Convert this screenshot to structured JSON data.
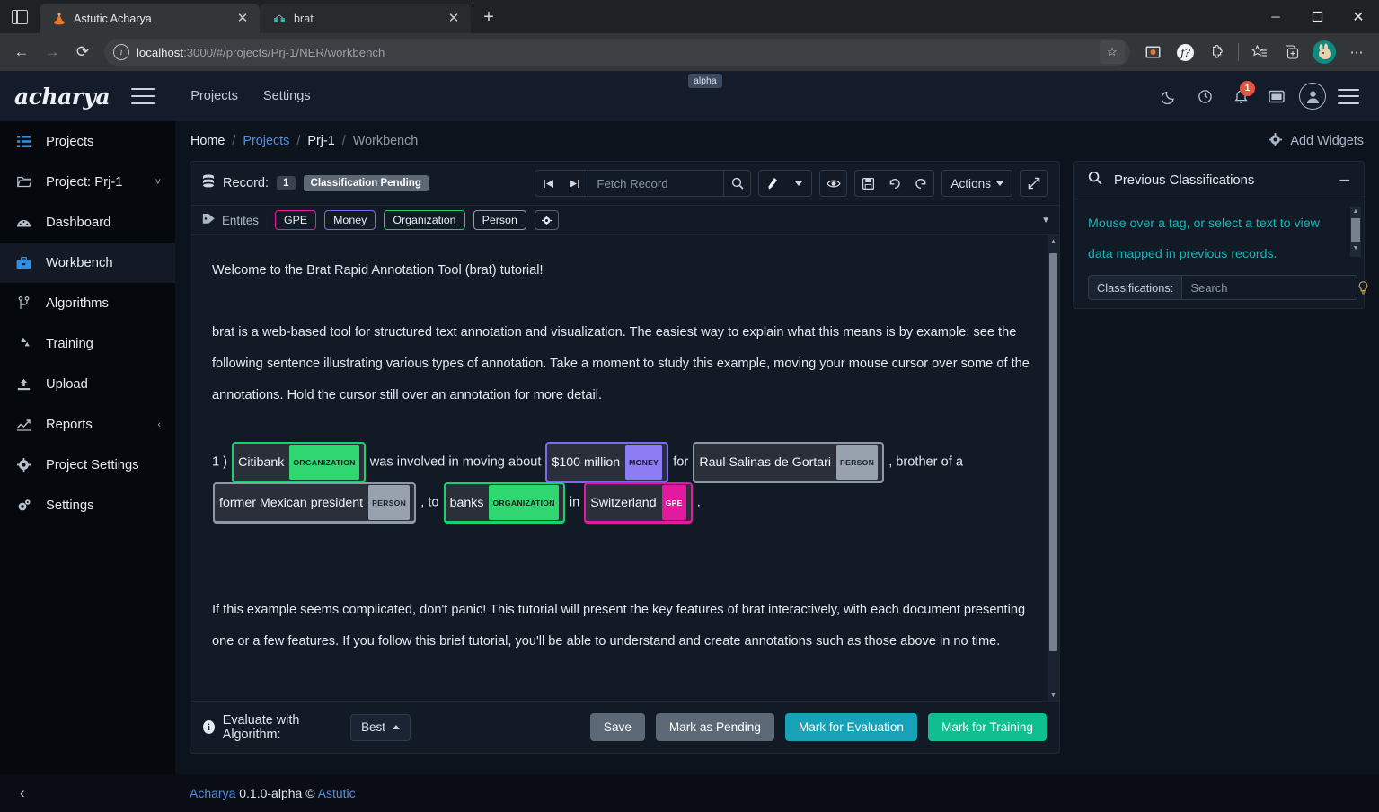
{
  "browser": {
    "tabs": [
      {
        "title": "Astutic Acharya",
        "favicon": "acharya-favicon",
        "active": true
      },
      {
        "title": "brat",
        "favicon": "brat-favicon",
        "active": false
      }
    ],
    "new_tab_label": "+",
    "nav": {
      "back": "←",
      "forward": "→",
      "reload": "⟳"
    },
    "url_prefix": "localhost",
    "url_rest": ":3000/#/projects/Prj-1/NER/workbench",
    "window": {
      "minimize": "─",
      "maximize": "☐",
      "close": "✕"
    }
  },
  "header": {
    "brand": "acharya",
    "alpha_badge": "alpha",
    "links": [
      {
        "label": "Projects"
      },
      {
        "label": "Settings"
      }
    ],
    "notification_count": "1"
  },
  "sidebar": {
    "items": [
      {
        "label": "Projects",
        "icon": "list-icon",
        "active": false,
        "accent": true
      },
      {
        "label": "Project: Prj-1",
        "icon": "folder-icon",
        "active": false,
        "accent": false,
        "caret": "˅"
      },
      {
        "label": "Dashboard",
        "icon": "dashboard-icon",
        "active": false,
        "accent": false
      },
      {
        "label": "Workbench",
        "icon": "briefcase-icon",
        "active": true,
        "accent": true
      },
      {
        "label": "Algorithms",
        "icon": "branch-icon",
        "active": false,
        "accent": false
      },
      {
        "label": "Training",
        "icon": "recycle-icon",
        "active": false,
        "accent": false
      },
      {
        "label": "Upload",
        "icon": "upload-icon",
        "active": false,
        "accent": false
      },
      {
        "label": "Reports",
        "icon": "chart-line-icon",
        "active": false,
        "accent": false,
        "caret": "‹"
      },
      {
        "label": "Project Settings",
        "icon": "gear-icon",
        "active": false,
        "accent": false
      },
      {
        "label": "Settings",
        "icon": "gears-icon",
        "active": false,
        "accent": false
      }
    ],
    "collapse": "‹"
  },
  "breadcrumb": {
    "home": "Home",
    "projects": "Projects",
    "project": "Prj-1",
    "current": "Workbench",
    "separator": "/"
  },
  "add_widgets": {
    "label": "Add Widgets",
    "icon": "gear-icon"
  },
  "record": {
    "label": "Record:",
    "number": "1",
    "status": "Classification Pending",
    "fetch_placeholder": "Fetch Record",
    "fetch_value": "",
    "actions_label": "Actions",
    "buttons": {
      "first": "⏮",
      "last": "⏭",
      "search": "🔍",
      "brush": "🖌",
      "eye": "◉",
      "save": "💾",
      "undo": "↺",
      "redo": "↻",
      "expand": "⤡"
    }
  },
  "entities": {
    "label": "Entites",
    "icon": "tag-icon",
    "tags": [
      {
        "label": "GPE",
        "color": "#e3199e"
      },
      {
        "label": "Money",
        "color": "#7a6bf0"
      },
      {
        "label": "Organization",
        "color": "#18d26e"
      },
      {
        "label": "Person",
        "color": "#8e99a6"
      }
    ],
    "settings_icon": "gear-icon"
  },
  "document": {
    "paragraph1": "Welcome to the Brat Rapid Annotation Tool (brat) tutorial!",
    "paragraph2": "brat is a web-based tool for structured text annotation and visualization. The easiest way to explain what this means is by example: see the following sentence illustrating various types of annotation. Take a moment to study this example, moving your mouse cursor over some of the annotations. Hold the cursor still over an annotation for more detail.",
    "annotated_sentence": {
      "number": "1 )",
      "segments": [
        {
          "type": "ann",
          "text": "Citibank",
          "label": "ORGANIZATION",
          "cls": "org"
        },
        {
          "type": "text",
          "text": " was involved in moving about "
        },
        {
          "type": "ann",
          "text": "$100 million",
          "label": "MONEY",
          "cls": "money"
        },
        {
          "type": "text",
          "text": " for "
        },
        {
          "type": "ann",
          "text": "Raul Salinas de Gortari",
          "label": "PERSON",
          "cls": "person"
        },
        {
          "type": "text",
          "text": ", brother of a "
        },
        {
          "type": "ann",
          "text": "former Mexican president",
          "label": "PERSON",
          "cls": "person"
        },
        {
          "type": "text",
          "text": ", to "
        },
        {
          "type": "ann",
          "text": "banks",
          "label": "ORGANIZATION",
          "cls": "org"
        },
        {
          "type": "text",
          "text": " in "
        },
        {
          "type": "ann",
          "text": "Switzerland",
          "label": "GPE",
          "cls": "gpe"
        },
        {
          "type": "text",
          "text": "."
        }
      ]
    },
    "paragraph3": "If this example seems complicated, don't panic! This tutorial will present the key features of brat interactively, with each document presenting one or a few features. If you follow this brief tutorial, you'll be able to understand and create annotations such as those above in no time."
  },
  "bottom": {
    "evaluate_label": "Evaluate with Algorithm:",
    "algorithm_value": "Best",
    "save_label": "Save",
    "mark_pending_label": "Mark as Pending",
    "mark_evaluation_label": "Mark for Evaluation",
    "mark_training_label": "Mark for Training"
  },
  "previous_classifications": {
    "title": "Previous Classifications",
    "icon": "search-icon",
    "minimize": "─",
    "hint": "Mouse over a tag, or select a text to view data mapped in previous records.",
    "classifications_label": "Classifications:",
    "search_placeholder": "Search",
    "bulb_icon": "bulb-icon"
  },
  "footer": {
    "app": "Acharya",
    "version": "0.1.0-alpha",
    "copyright": "©",
    "company": "Astutic"
  },
  "colors": {
    "accent_blue": "#2f8fe0",
    "link_blue": "#4f8fe0",
    "teal": "#17b3b8",
    "green": "#0fbf8f",
    "cyan_btn": "#17a2b8",
    "badge_red": "#e8543f"
  }
}
